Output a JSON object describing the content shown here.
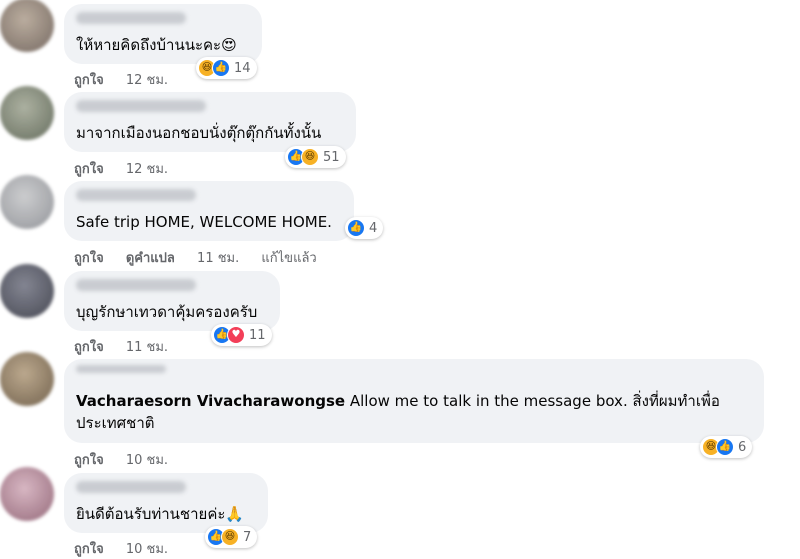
{
  "comments": [
    {
      "text": "ให้หายคิดถึงบ้านนะคะ😍",
      "reactions": [
        "haha",
        "like"
      ],
      "count": "14",
      "actions": [
        "ถูกใจ",
        "12 ชม."
      ]
    },
    {
      "text": "มาจากเมืองนอกชอบนั่งตุ๊กตุ๊กกันทั้งนั้น",
      "reactions": [
        "like",
        "haha"
      ],
      "count": "51",
      "actions": [
        "ถูกใจ",
        "12 ชม."
      ]
    },
    {
      "text": "Safe trip HOME, WELCOME HOME.",
      "reactions": [
        "like"
      ],
      "count": "4",
      "actions": [
        "ถูกใจ",
        "ดูคำแปล",
        "11 ชม.",
        "แก้ไขแล้ว"
      ]
    },
    {
      "text": "บุญรักษาเทวดาคุ้มครองครับ",
      "reactions": [
        "like",
        "love"
      ],
      "count": "11",
      "actions": [
        "ถูกใจ",
        "11 ชม."
      ]
    },
    {
      "author": "Vacharaesorn Vivacharawongse",
      "text": " Allow me to talk in the message box. สิ่งที่ผมทำเพื่อประเทศชาติ",
      "reactions": [
        "haha",
        "like"
      ],
      "count": "6",
      "actions": [
        "ถูกใจ",
        "10 ชม."
      ]
    },
    {
      "text": "ยินดีต้อนรับท่านชายค่ะ🙏",
      "reactions": [
        "like",
        "haha"
      ],
      "count": "7",
      "actions": [
        "ถูกใจ",
        "10 ชม."
      ]
    }
  ],
  "colors": {
    "bubble": "#f0f2f5",
    "like": "#1877f2",
    "haha": "#f7b125",
    "love": "#f33e58",
    "meta": "#65676b"
  },
  "icons": {
    "like": "thumbs-up-icon",
    "haha": "laughing-face-icon",
    "love": "heart-icon"
  }
}
